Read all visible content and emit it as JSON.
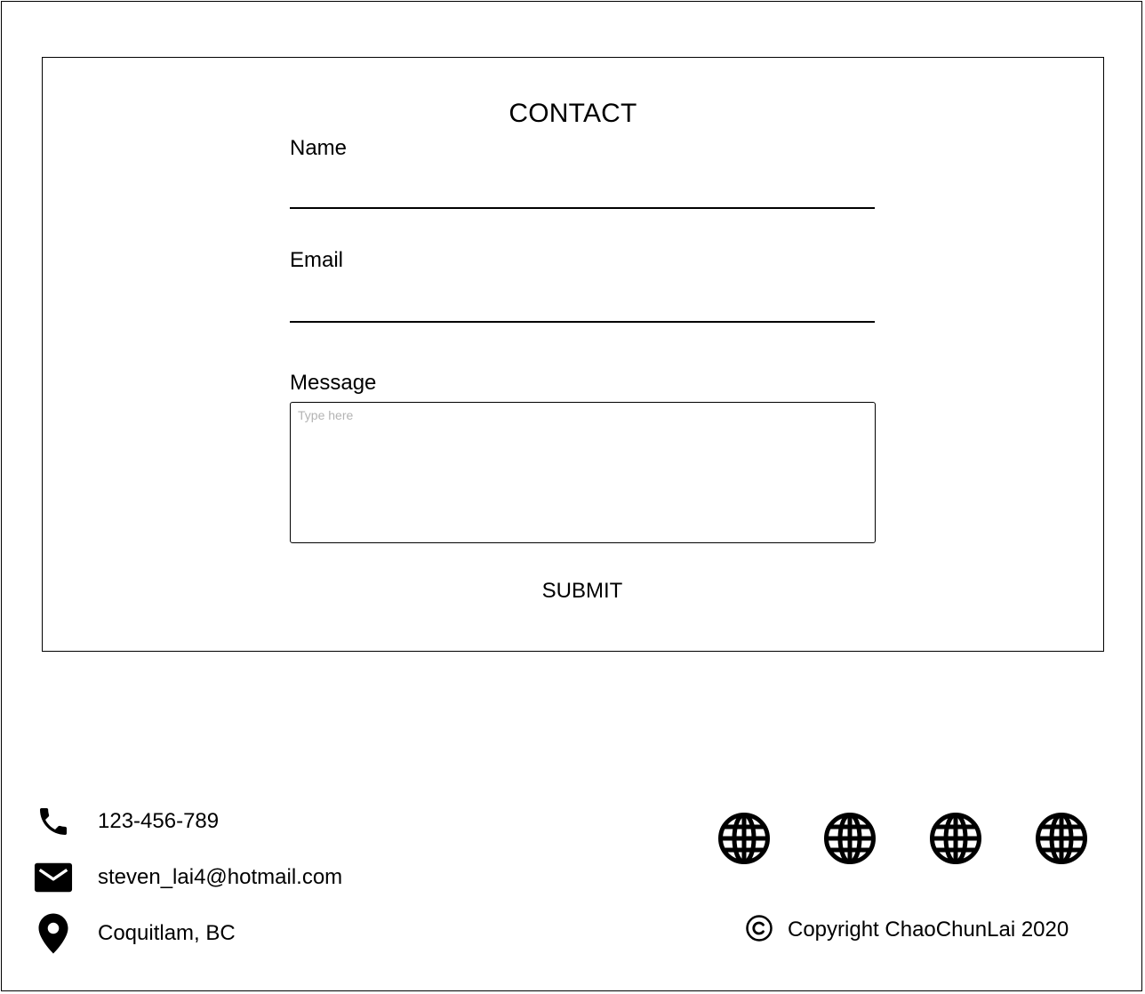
{
  "contact": {
    "title": "CONTACT",
    "name_label": "Name",
    "name_value": "",
    "email_label": "Email",
    "email_value": "",
    "message_label": "Message",
    "message_placeholder": "Type here",
    "submit_label": "SUBMIT"
  },
  "footer": {
    "phone": {
      "icon": "phone-icon",
      "text": "123-456-789"
    },
    "email": {
      "icon": "mail-icon",
      "text": "steven_lai4@hotmail.com"
    },
    "location": {
      "icon": "location-pin-icon",
      "text": "Coquitlam, BC"
    },
    "social_links": [
      {
        "icon": "globe-icon"
      },
      {
        "icon": "globe-icon"
      },
      {
        "icon": "globe-icon"
      },
      {
        "icon": "globe-icon"
      }
    ],
    "copyright": {
      "icon": "copyright-icon",
      "text": "Copyright ChaoChunLai 2020"
    }
  },
  "colors": {
    "text": "#000000",
    "background": "#ffffff",
    "placeholder": "#b3b3b3"
  }
}
